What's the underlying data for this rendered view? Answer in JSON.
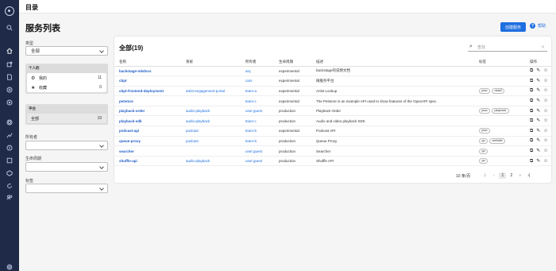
{
  "header": {
    "title": "目录"
  },
  "page": {
    "title": "服务列表",
    "create_label": "创建服务",
    "help_label": "帮助"
  },
  "filters": {
    "type_label": "类型",
    "type_value": "全部",
    "personal": {
      "header": "个人的",
      "owned_label": "我的",
      "owned_count": "11",
      "starred_label": "收藏",
      "starred_count": "0"
    },
    "org": {
      "header": "平台",
      "all_label": "全部",
      "all_count": "19"
    },
    "owner_label": "所有者",
    "lifecycle_label": "生命周期",
    "tags_label": "标签"
  },
  "table": {
    "title": "全部(19)",
    "search_placeholder": "查找",
    "columns": [
      "名称",
      "系统",
      "所有者",
      "生命周期",
      "描述",
      "标签",
      "操作"
    ],
    "rows": [
      {
        "name": "backstage-mkdocs",
        "system": "",
        "owner": "arq",
        "lifecycle": "experimental",
        "description": "backstage的说明文档",
        "tags": []
      },
      {
        "name": "cbpt",
        "system": "",
        "owner": "cars",
        "lifecycle": "experimental",
        "description": "微服务平台",
        "tags": []
      },
      {
        "name": "cbpt-frontend-deployment",
        "system": "artist-engagement-portal",
        "owner": "team-a",
        "lifecycle": "experimental",
        "description": "Artist Lookup",
        "tags": [
          "java",
          "data2"
        ]
      },
      {
        "name": "petstore",
        "system": "",
        "owner": "team-c",
        "lifecycle": "experimental",
        "description": "The Petstore is an example API used to show features of the OpenAPI spec.",
        "tags": []
      },
      {
        "name": "playback-order",
        "system": "audio-playback",
        "owner": "user:guest",
        "lifecycle": "production",
        "description": "Playback Order",
        "tags": [
          "java",
          "playback"
        ]
      },
      {
        "name": "playback-sdk",
        "system": "audio-playback",
        "owner": "team-c",
        "lifecycle": "production",
        "description": "Audio and video playback SDK",
        "tags": []
      },
      {
        "name": "podcast-api",
        "system": "podcast",
        "owner": "team-b",
        "lifecycle": "experimental",
        "description": "Podcast API",
        "tags": [
          "java"
        ]
      },
      {
        "name": "queue-proxy",
        "system": "podcast",
        "owner": "team-b",
        "lifecycle": "production",
        "description": "Queue Proxy",
        "tags": [
          "go",
          "website"
        ]
      },
      {
        "name": "searcher",
        "system": "",
        "owner": "user:guest",
        "lifecycle": "production",
        "description": "Searcher",
        "tags": [
          "go"
        ]
      },
      {
        "name": "shuffle-api",
        "system": "audio-playback",
        "owner": "user:guest",
        "lifecycle": "production",
        "description": "Shuffle API",
        "tags": [
          "go"
        ]
      }
    ],
    "actions": {
      "view_icon": "external-link-icon",
      "edit_icon": "pencil-icon",
      "star_icon": "star-outline-icon"
    }
  },
  "pagination": {
    "page_size_label": "10 条/页",
    "pages": [
      "1",
      "2"
    ],
    "current_page": "1"
  },
  "colors": {
    "nav_bg": "#1e2a47",
    "primary": "#1e6fe0",
    "link": "#1e5bc6"
  }
}
